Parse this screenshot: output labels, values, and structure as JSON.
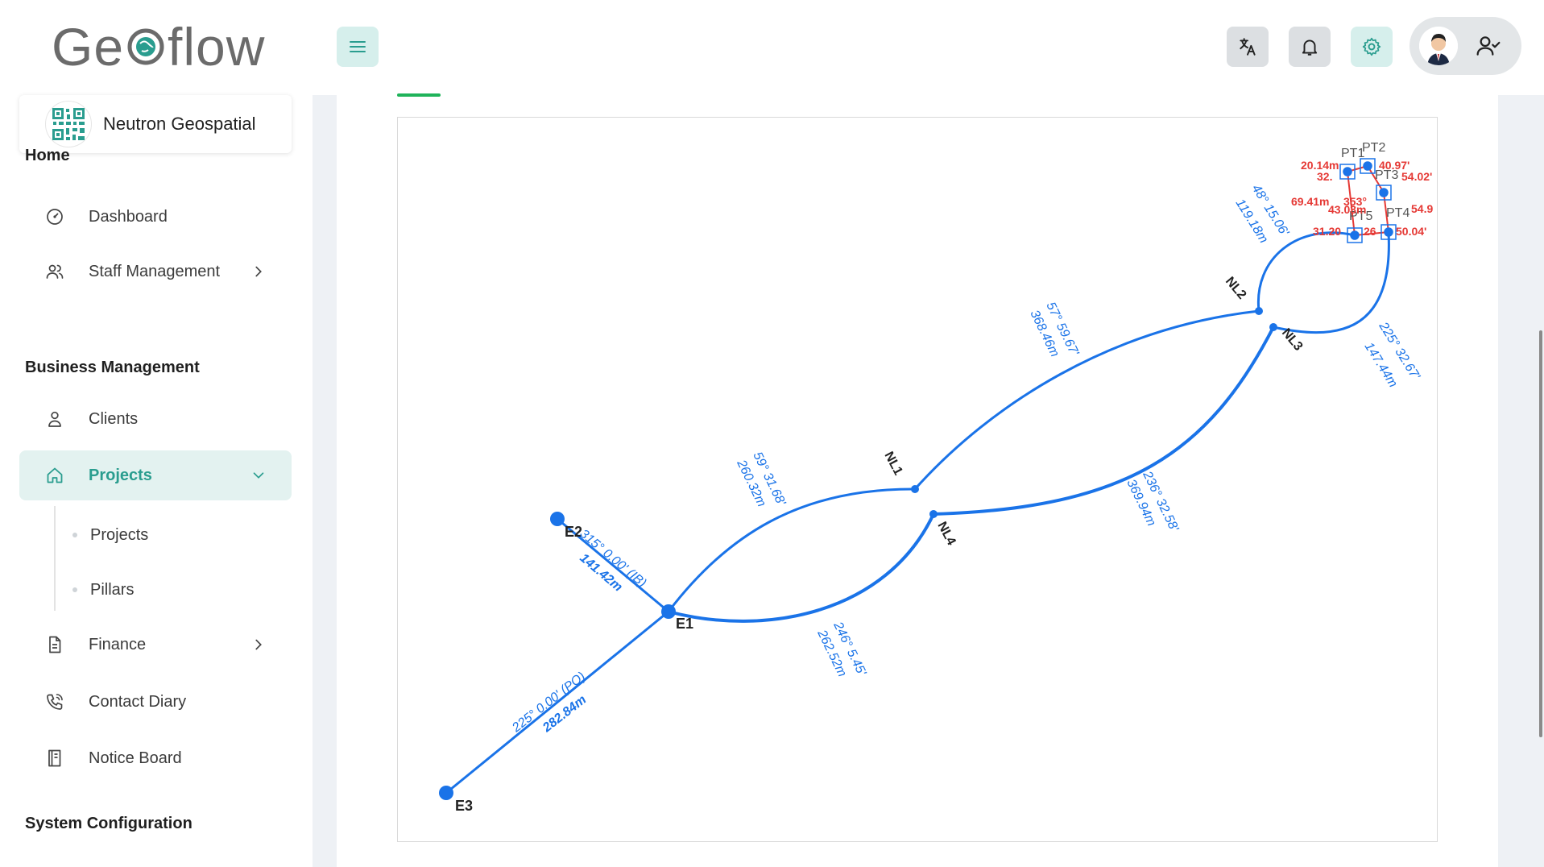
{
  "header": {
    "logo_text_left": "Ge",
    "logo_text_right": "flow",
    "colors": {
      "teal_button": "#d6efec",
      "gray_button": "#dcdfe2",
      "accent": "#2a9d8f"
    },
    "icons": [
      "menu-icon",
      "translate-icon",
      "bell-icon",
      "gear-icon",
      "user-check-icon"
    ]
  },
  "sidebar": {
    "org_name": "Neutron Geospatial",
    "sections": {
      "home": "Home",
      "business": "Business Management",
      "system": "System Configuration"
    },
    "items": {
      "dashboard": "Dashboard",
      "staff": "Staff Management",
      "clients": "Clients",
      "projects": "Projects",
      "finance": "Finance",
      "contact_diary": "Contact Diary",
      "notice_board": "Notice Board"
    },
    "sub_items": {
      "projects": "Projects",
      "pillars": "Pillars"
    }
  },
  "map": {
    "points": {
      "E1": "E1",
      "E2": "E2",
      "E3": "E3",
      "NL1": "NL1",
      "NL2": "NL2",
      "NL3": "NL3",
      "NL4": "NL4",
      "PT1": "PT1",
      "PT2": "PT2",
      "PT3": "PT3",
      "PT4": "PT4",
      "PT5": "PT5"
    },
    "segments": {
      "e2_e1_bearing": "315° 0.00' (IB)",
      "e2_e1_dist": "141.42m",
      "e3_e1_bearing": "225° 0.00' (PO)",
      "e3_e1_dist": "282.84m",
      "e1_nl1_bearing": "59° 31.68'",
      "e1_nl1_dist": "260.32m",
      "e1_nl4_bearing": "246° 5.45'",
      "e1_nl4_dist": "262.52m",
      "nl1_nl2_bearing": "57° 59.67'",
      "nl1_nl2_dist": "368.46m",
      "nl4_nl3_bearing": "236° 32.58'",
      "nl4_nl3_dist": "369.94m",
      "nl2_pt5_bearing": "48° 15.06'",
      "nl2_pt5_dist": "119.18m",
      "nl3_pt4_bearing": "225° 32.67'",
      "nl3_pt4_dist": "147.44m"
    },
    "pillar_labels": {
      "a": "20.14m",
      "b": "32.",
      "c": "40.97'",
      "d": "54.02'",
      "e": "69.41m",
      "f": "353°",
      "g": "43.03m",
      "h": "54.9",
      "i": "31.20",
      "j": "26",
      "k": "50.04'"
    },
    "colors": {
      "line": "#1a73e8",
      "pillar": "#e53935"
    }
  }
}
